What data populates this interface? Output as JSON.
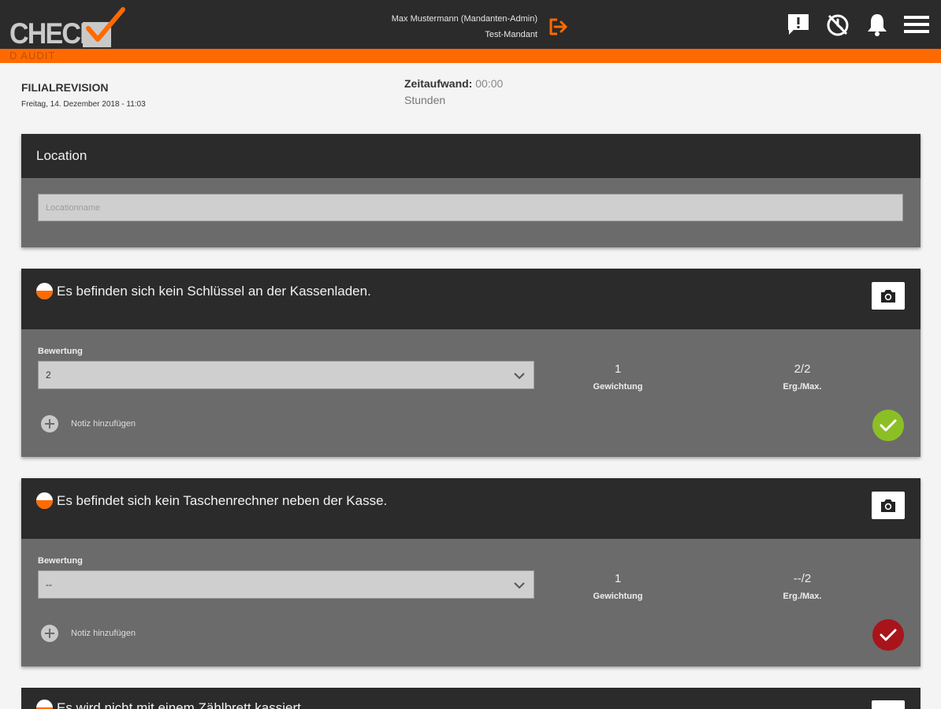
{
  "app": {
    "logo_text": "CHECK",
    "section_label": "D AUDIT"
  },
  "header": {
    "user_name": "Max Mustermann (Mandanten-Admin)",
    "tenant": "Test-Mandant",
    "icons": [
      "logout-icon",
      "feedback-icon",
      "timer-icon",
      "notification-bell-icon",
      "hamburger-menu-icon"
    ]
  },
  "audit": {
    "title": "FILIALREVISION",
    "date": "Freitag, 14. Dezember 2018 - 11:03",
    "time_label": "Zeitaufwand:",
    "time_value": "00:00",
    "time_unit": "Stunden"
  },
  "location": {
    "heading": "Location",
    "placeholder": "Locationname",
    "value": ""
  },
  "questions": [
    {
      "text": "Es befinden sich kein Schlüssel an der Kassenladen.",
      "rating_label": "Bewertung",
      "rating_value": "2",
      "weight_value": "1",
      "weight_label": "Gewichtung",
      "result_value": "2/2",
      "result_label": "Erg./Max.",
      "note_label": "Notiz hinzufügen",
      "status_color": "#8cbf26"
    },
    {
      "text": "Es befindet sich kein Taschenrechner neben der Kasse.",
      "rating_label": "Bewertung",
      "rating_value": "--",
      "weight_value": "1",
      "weight_label": "Gewichtung",
      "result_value": "--/2",
      "result_label": "Erg./Max.",
      "note_label": "Notiz hinzufügen",
      "status_color": "#a8141a"
    },
    {
      "text": "Es wird nicht mit einem Zählbrett kassiert."
    }
  ],
  "colors": {
    "accent": "#ff6a00",
    "dark": "#2b2b2b",
    "card": "#6b6b6b"
  }
}
